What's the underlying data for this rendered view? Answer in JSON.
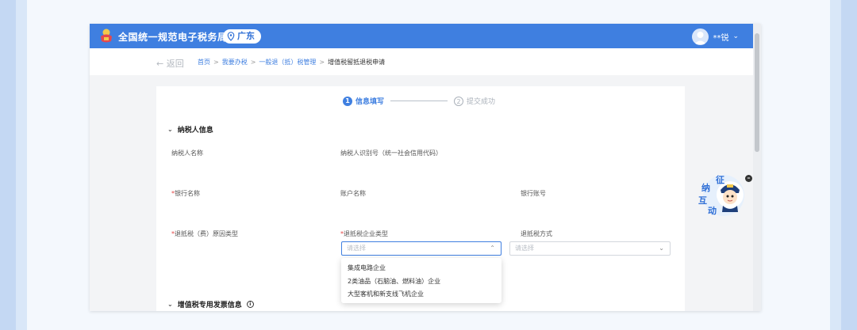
{
  "header": {
    "site_title": "全国统一规范电子税务局",
    "region": "广东",
    "user_name": "**锐",
    "user_chevron": "⌄"
  },
  "nav": {
    "back_label": "← 返回",
    "breadcrumbs": [
      "首页",
      "我要办税",
      "一般退（抵）税管理",
      "增值税留抵退税申请"
    ],
    "separator": ">"
  },
  "steps": [
    {
      "num": "1",
      "label": "信息填写",
      "active": true
    },
    {
      "num": "2",
      "label": "提交成功",
      "active": false
    }
  ],
  "sections": {
    "taxpayer_info": {
      "title": "纳税人信息",
      "caret": "⌄"
    },
    "vat_invoice": {
      "title": "增值税专用发票信息",
      "caret": "⌄",
      "info_glyph": "i"
    }
  },
  "fields": {
    "taxpayer_name": {
      "label": "纳税人名称"
    },
    "taxpayer_id": {
      "label": "纳税人识别号（统一社会信用代码）"
    },
    "bank_name": {
      "label": "银行名称",
      "required_mark": "*"
    },
    "account_name": {
      "label": "账户名称"
    },
    "bank_account": {
      "label": "银行账号"
    },
    "refund_reason": {
      "label": "退抵税（费）原因类型",
      "required_mark": "*"
    },
    "enterprise_type": {
      "label": "退抵税企业类型",
      "required_mark": "*",
      "placeholder": "请选择",
      "arrow": "⌃"
    },
    "refund_method": {
      "label": "退抵税方式",
      "placeholder": "请选择",
      "arrow": "⌄"
    }
  },
  "dropdown_options": [
    "集成电路企业",
    "2类油品（石脑油、燃料油）企业",
    "大型客机和新支线飞机企业"
  ],
  "mascot": {
    "line1": "征",
    "line2": "纳",
    "line3": "互",
    "line4": "动",
    "close_glyph": "–"
  },
  "colors": {
    "brand_blue": "#3f7fe0",
    "required_red": "#e54545"
  }
}
